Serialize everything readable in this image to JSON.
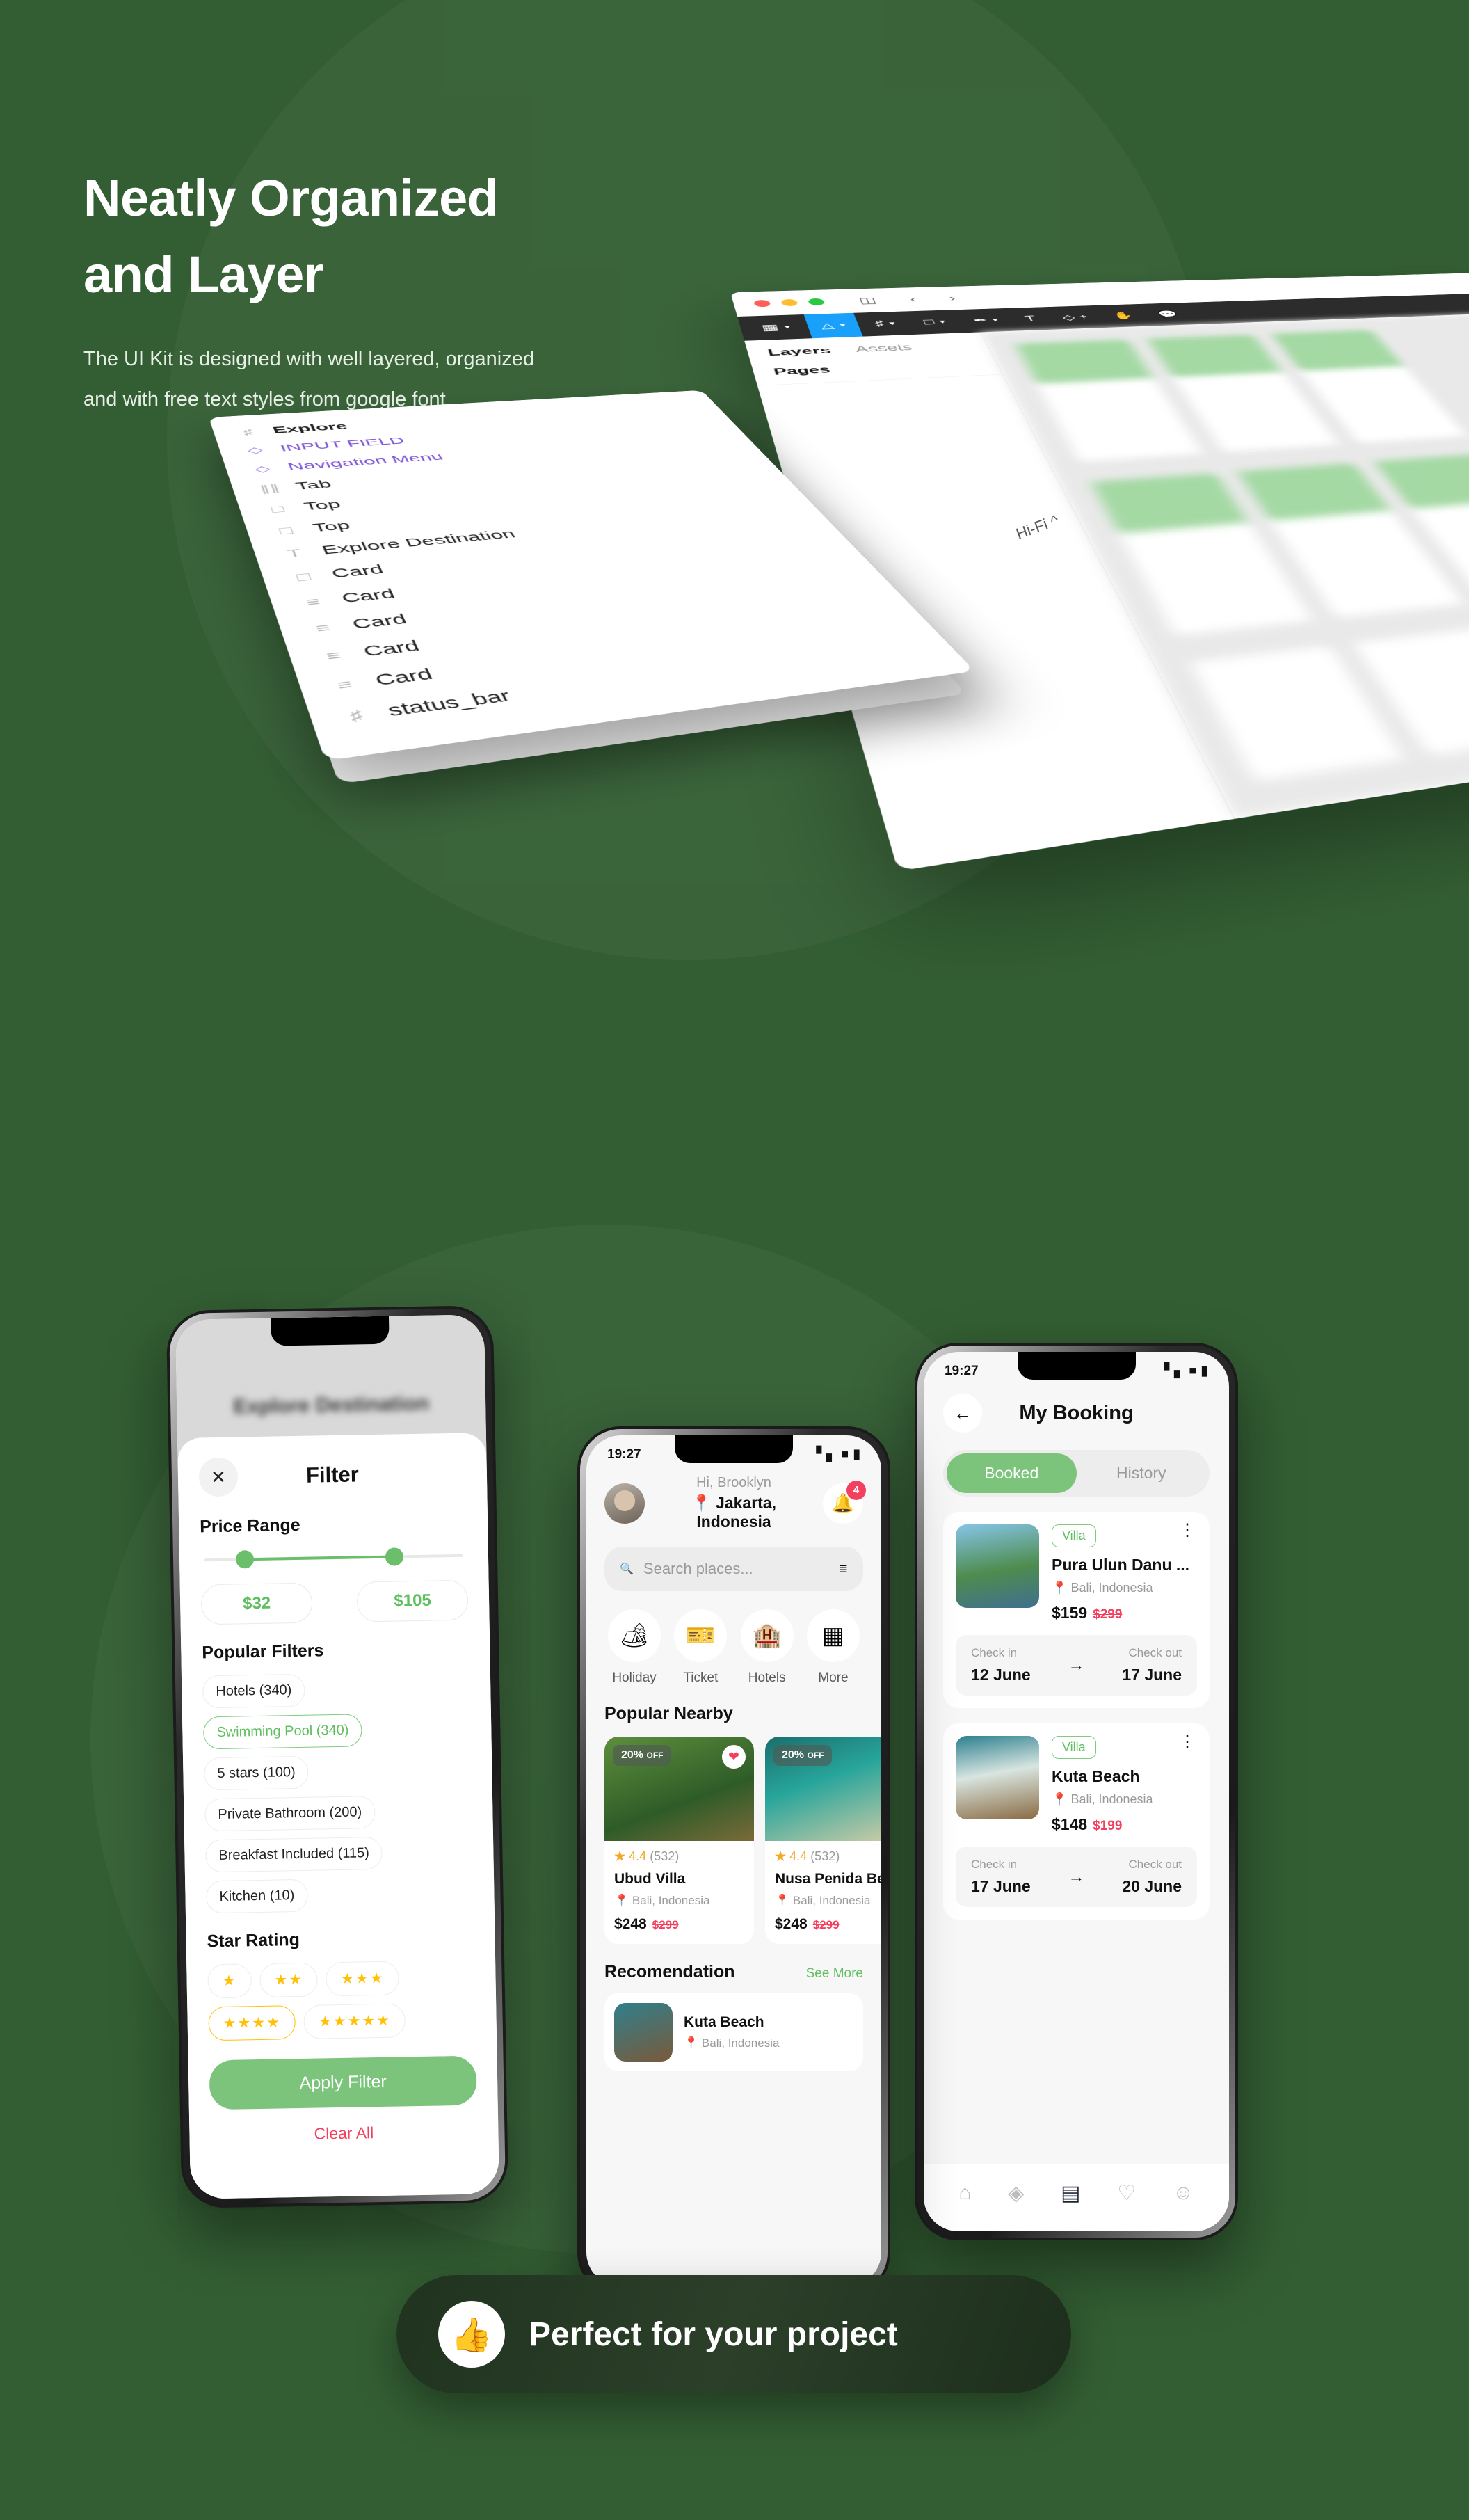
{
  "hero": {
    "title_line1": "Neatly Organized",
    "title_line2": "and Layer",
    "body": "The UI Kit is designed with well layered, organized and with free text styles from google font"
  },
  "figma": {
    "window_title": "",
    "tabs": {
      "layers": "Layers",
      "assets": "Assets"
    },
    "pages_label": "Pages",
    "zoom_label": "Hi-Fi",
    "traffic_lights": [
      "close-red",
      "minimize-yellow",
      "maximize-green"
    ],
    "toolbar_icons": [
      "components-icon",
      "move-tool-icon",
      "frame-tool-icon",
      "shape-tool-icon",
      "pen-tool-icon",
      "text-tool-icon",
      "add-component-icon",
      "hand-tool-icon",
      "comment-icon"
    ],
    "layers": [
      {
        "icon": "frame-icon",
        "label": "Explore",
        "style": "bold"
      },
      {
        "icon": "component-icon",
        "label": "INPUT FIELD",
        "style": "purple"
      },
      {
        "icon": "component-icon",
        "label": "Navigation Menu",
        "style": "purple"
      },
      {
        "icon": "mask-icon",
        "label": "Tab",
        "style": "normal"
      },
      {
        "icon": "group-icon",
        "label": "Top",
        "style": "normal"
      },
      {
        "icon": "group-icon",
        "label": "Top",
        "style": "normal"
      },
      {
        "icon": "text-icon",
        "label": "Explore Destination",
        "style": "normal"
      },
      {
        "icon": "group-icon",
        "label": "Card",
        "style": "normal"
      },
      {
        "icon": "autolayout-icon",
        "label": "Card",
        "style": "normal"
      },
      {
        "icon": "autolayout-icon",
        "label": "Card",
        "style": "normal"
      },
      {
        "icon": "autolayout-icon",
        "label": "Card",
        "style": "normal"
      },
      {
        "icon": "autolayout-icon",
        "label": "Card",
        "style": "normal"
      },
      {
        "icon": "frame-icon",
        "label": "status_bar",
        "style": "normal"
      }
    ]
  },
  "phone1": {
    "background_title": "Explore Destination",
    "close_label": "✕",
    "title": "Filter",
    "price_section": "Price Range",
    "price_min": "$32",
    "price_max": "$105",
    "popular_section": "Popular Filters",
    "popular_chips": [
      {
        "label": "Hotels (340)",
        "selected": false
      },
      {
        "label": "Swimming Pool (340)",
        "selected": true
      },
      {
        "label": "5 stars (100)",
        "selected": false
      },
      {
        "label": "Private Bathroom (200)",
        "selected": false
      },
      {
        "label": "Breakfast Included (115)",
        "selected": false
      },
      {
        "label": "Kitchen (10)",
        "selected": false
      }
    ],
    "star_section": "Star Rating",
    "star_chips": [
      {
        "stars": "★",
        "selected": false
      },
      {
        "stars": "★★",
        "selected": false
      },
      {
        "stars": "★★★",
        "selected": false
      },
      {
        "stars": "★★★★",
        "selected": true
      },
      {
        "stars": "★★★★★",
        "selected": false
      }
    ],
    "apply_label": "Apply Filter",
    "clear_label": "Clear All"
  },
  "phone2": {
    "time": "19:27",
    "greeting": "Hi, Brooklyn",
    "location": "Jakarta, Indonesia",
    "notification_count": "4",
    "search_placeholder": "Search places...",
    "categories": [
      {
        "icon": "🏕",
        "label": "Holiday"
      },
      {
        "icon": "🎫",
        "label": "Ticket"
      },
      {
        "icon": "🏨",
        "label": "Hotels"
      },
      {
        "icon": "▦",
        "label": "More"
      }
    ],
    "popular_title": "Popular Nearby",
    "popular_cards": [
      {
        "discount": "20%",
        "discount_suffix": "OFF",
        "rating": "4.4",
        "reviews": "(532)",
        "name": "Ubud Villa",
        "location": "Bali, Indonesia",
        "price": "$248",
        "old_price": "$299",
        "liked": true
      },
      {
        "discount": "20%",
        "discount_suffix": "OFF",
        "rating": "4.4",
        "reviews": "(532)",
        "name": "Nusa Penida Beach",
        "location": "Bali, Indonesia",
        "price": "$248",
        "old_price": "$299",
        "liked": false
      }
    ],
    "rec_title": "Recomendation",
    "rec_more": "See More",
    "rec_cards": [
      {
        "name": "Kuta Beach",
        "location": "Bali, Indonesia"
      }
    ]
  },
  "phone3": {
    "time": "19:27",
    "title": "My Booking",
    "tabs": [
      {
        "label": "Booked",
        "active": true
      },
      {
        "label": "History",
        "active": false
      }
    ],
    "bookings": [
      {
        "tag": "Villa",
        "name": "Pura Ulun Danu ...",
        "location": "Bali, Indonesia",
        "price": "$159",
        "old_price": "$299",
        "checkin_label": "Check in",
        "checkin": "12 June",
        "checkout_label": "Check out",
        "checkout": "17 June"
      },
      {
        "tag": "Villa",
        "name": "Kuta Beach",
        "location": "Bali, Indonesia",
        "price": "$148",
        "old_price": "$199",
        "checkin_label": "Check in",
        "checkin": "17 June",
        "checkout_label": "Check out",
        "checkout": "20 June"
      }
    ],
    "tabbar": [
      {
        "icon": "home-icon",
        "active": false
      },
      {
        "icon": "explore-icon",
        "active": false
      },
      {
        "icon": "booking-icon",
        "active": true
      },
      {
        "icon": "heart-icon",
        "active": false
      },
      {
        "icon": "profile-icon",
        "active": false
      }
    ]
  },
  "banner": {
    "emoji": "👍",
    "text": "Perfect for your project"
  },
  "colors": {
    "background": "#335E33",
    "accent_green": "#7CC47C",
    "link_green": "#5FBF5F",
    "danger_red": "#F43F5E",
    "star_yellow": "#FFC107",
    "figma_blue": "#18A0FB",
    "purple_component": "#7B51D8"
  }
}
